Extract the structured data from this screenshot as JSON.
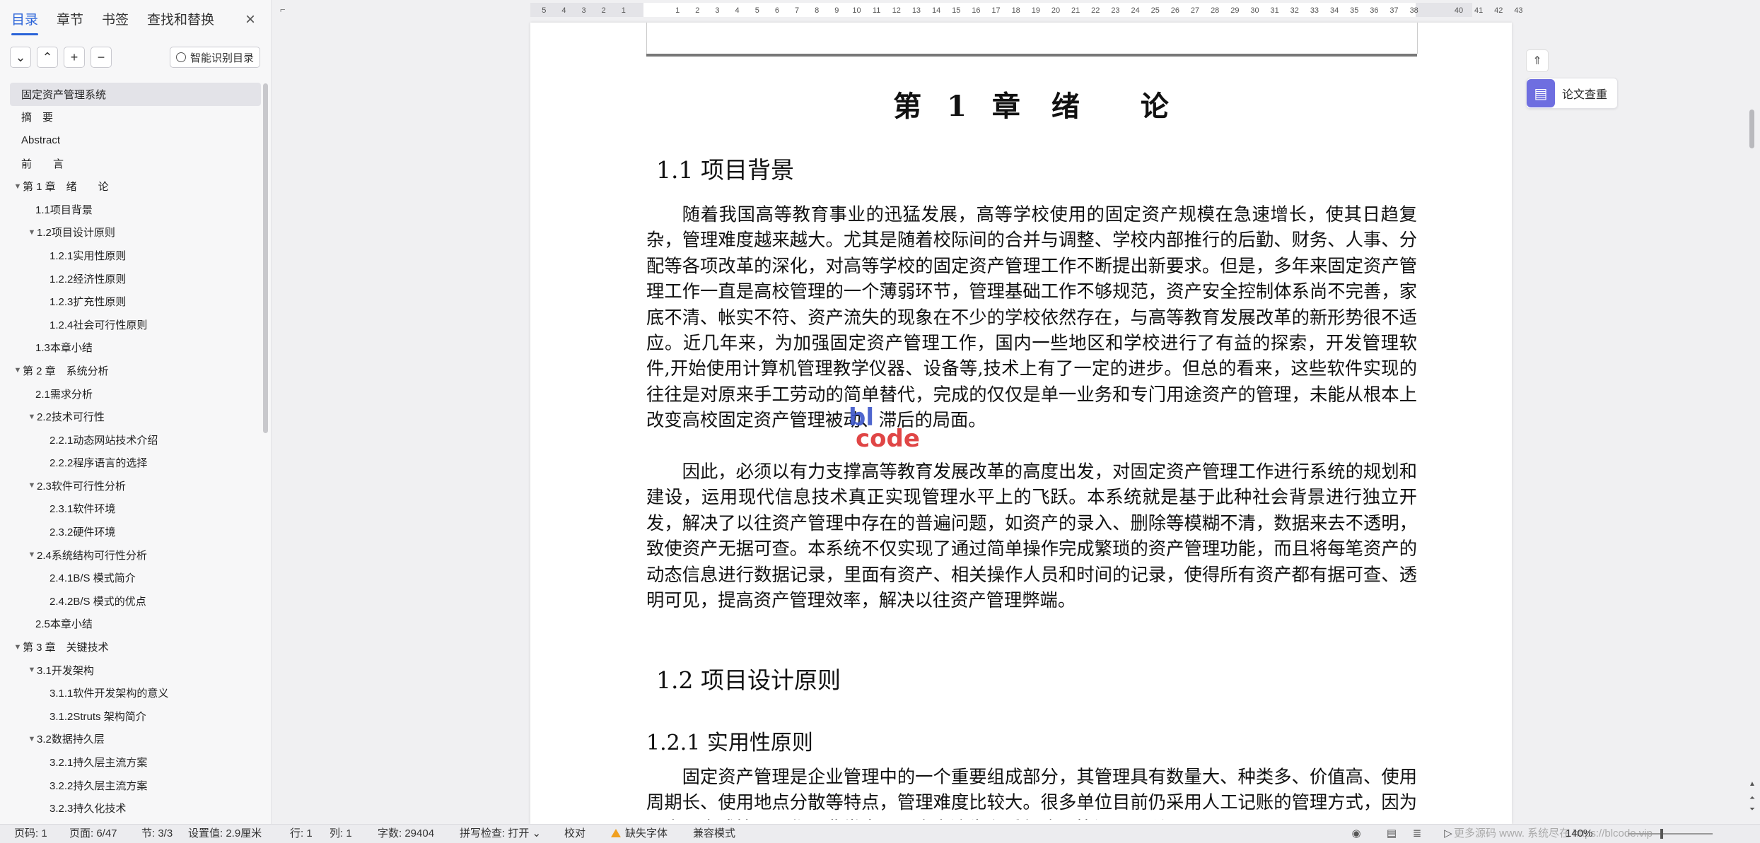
{
  "nav": {
    "tabs": [
      "目录",
      "章节",
      "书签",
      "查找和替换"
    ],
    "close_icon": "×",
    "tools": [
      {
        "name": "collapse-all-button",
        "icon": "chevron-down-icon",
        "glyph": "⌄"
      },
      {
        "name": "expand-all-button",
        "icon": "chevron-up-icon",
        "glyph": "⌃"
      },
      {
        "name": "add-level-button",
        "icon": "plus-icon",
        "glyph": "+"
      },
      {
        "name": "remove-level-button",
        "icon": "minus-icon",
        "glyph": "−"
      }
    ],
    "smart_toc_label": "智能识别目录",
    "toc": [
      {
        "label": "固定资产管理系统",
        "level": 0,
        "arrow": "",
        "active": true
      },
      {
        "label": "摘　要",
        "level": 0,
        "arrow": ""
      },
      {
        "label": "Abstract",
        "level": 0,
        "arrow": ""
      },
      {
        "label": "前　　言",
        "level": 0,
        "arrow": ""
      },
      {
        "label": "第 1 章　绪　　论",
        "level": 0,
        "arrow": "▼"
      },
      {
        "label": "1.1项目背景",
        "level": 1,
        "arrow": ""
      },
      {
        "label": "1.2项目设计原则",
        "level": 1,
        "arrow": "▼"
      },
      {
        "label": "1.2.1实用性原则",
        "level": 2,
        "arrow": ""
      },
      {
        "label": "1.2.2经济性原则",
        "level": 2,
        "arrow": ""
      },
      {
        "label": "1.2.3扩充性原则",
        "level": 2,
        "arrow": ""
      },
      {
        "label": "1.2.4社会可行性原则",
        "level": 2,
        "arrow": ""
      },
      {
        "label": "1.3本章小结",
        "level": 1,
        "arrow": ""
      },
      {
        "label": "第 2 章　系统分析",
        "level": 0,
        "arrow": "▼"
      },
      {
        "label": "2.1需求分析",
        "level": 1,
        "arrow": ""
      },
      {
        "label": "2.2技术可行性",
        "level": 1,
        "arrow": "▼"
      },
      {
        "label": "2.2.1动态网站技术介绍",
        "level": 2,
        "arrow": ""
      },
      {
        "label": "2.2.2程序语言的选择",
        "level": 2,
        "arrow": ""
      },
      {
        "label": "2.3软件可行性分析",
        "level": 1,
        "arrow": "▼"
      },
      {
        "label": "2.3.1软件环境",
        "level": 2,
        "arrow": ""
      },
      {
        "label": "2.3.2硬件环境",
        "level": 2,
        "arrow": ""
      },
      {
        "label": "2.4系统结构可行性分析",
        "level": 1,
        "arrow": "▼"
      },
      {
        "label": "2.4.1B/S 模式简介",
        "level": 2,
        "arrow": ""
      },
      {
        "label": "2.4.2B/S 模式的优点",
        "level": 2,
        "arrow": ""
      },
      {
        "label": "2.5本章小结",
        "level": 1,
        "arrow": ""
      },
      {
        "label": "第 3 章　关键技术",
        "level": 0,
        "arrow": "▼"
      },
      {
        "label": "3.1开发架构",
        "level": 1,
        "arrow": "▼"
      },
      {
        "label": "3.1.1软件开发架构的意义",
        "level": 2,
        "arrow": ""
      },
      {
        "label": "3.1.2Struts 架构简介",
        "level": 2,
        "arrow": ""
      },
      {
        "label": "3.2数据持久层",
        "level": 1,
        "arrow": "▼"
      },
      {
        "label": "3.2.1持久层主流方案",
        "level": 2,
        "arrow": ""
      },
      {
        "label": "3.2.2持久层主流方案",
        "level": 2,
        "arrow": ""
      },
      {
        "label": "3.2.3持久化技术",
        "level": 2,
        "arrow": ""
      }
    ]
  },
  "ruler": {
    "left_ticks": [
      "5",
      "4",
      "3",
      "2",
      "1"
    ],
    "ticks": [
      "1",
      "2",
      "3",
      "4",
      "5",
      "6",
      "7",
      "8",
      "9",
      "10",
      "11",
      "12",
      "13",
      "14",
      "15",
      "16",
      "17",
      "18",
      "19",
      "20",
      "21",
      "22",
      "23",
      "24",
      "25",
      "26",
      "27",
      "28",
      "29",
      "30",
      "31",
      "32",
      "33",
      "34",
      "35",
      "36",
      "37",
      "38"
    ],
    "right_ticks": [
      "40",
      "41",
      "42",
      "43"
    ]
  },
  "doc": {
    "chapter_title": "第 1 章　绪　　论",
    "h_1_1": "1.1  项目背景",
    "p1": "随着我国高等教育事业的迅猛发展，高等学校使用的固定资产规模在急速增长，使其日趋复杂，管理难度越来越大。尤其是随着校际间的合并与调整、学校内部推行的后勤、财务、人事、分配等各项改革的深化，对高等学校的固定资产管理工作不断提出新要求。但是，多年来固定资产管理工作一直是高校管理的一个薄弱环节，管理基础工作不够规范，资产安全控制体系尚不完善，家底不清、帐实不符、资产流失的现象在不少的学校依然存在，与高等教育发展改革的新形势很不适应。近几年来，为加强固定资产管理工作，国内一些地区和学校进行了有益的探索，开发管理软件,开始使用计算机管理教学仪器、设备等,技术上有了一定的进步。但总的看来，这些软件实现的往往是对原来手工劳动的简单替代，完成的仅仅是单一业务和专门用途资产的管理，未能从根本上改变高校固定资产管理被动、滞后的局面。",
    "p2": "因此，必须以有力支撑高等教育发展改革的高度出发，对固定资产管理工作进行系统的规划和建设，运用现代信息技术真正实现管理水平上的飞跃。本系统就是基于此种社会背景进行独立开发，解决了以往资产管理中存在的普遍问题，如资产的录入、删除等模糊不清，数据来去不透明，致使资产无据可查。本系统不仅实现了通过简单操作完成繁琐的资产管理功能，而且将每笔资产的动态信息进行数据记录，里面有资产、相关操作人员和时间的记录，使得所有资产都有据可查、透明可见，提高资产管理效率，解决以往资产管理弊端。",
    "h_1_2": "1.2  项目设计原则",
    "h_1_2_1": "1.2.1  实用性原则",
    "p3": "固定资产管理是企业管理中的一个重要组成部分，其管理具有数量大、种类多、价值高、使用周期长、使用地点分散等特点，管理难度比较大。很多单位目前仍采用人工记账的管理方式，因为以人工方式管理工作量非常大，且资产流失和重复购置等问题，所",
    "watermark_top": "bl",
    "watermark_bottom": "code"
  },
  "side": {
    "up_icon": "⇑",
    "paper_check_label": "论文查重"
  },
  "status": {
    "page_num": "页码: 1",
    "page_of": "页面: 6/47",
    "section": "节: 3/3",
    "setting": "设置值: 2.9厘米",
    "row": "行: 1",
    "col": "列: 1",
    "word_count": "字数: 29404",
    "spell_check": "拼写检查: 打开",
    "proofread": "校对",
    "missing_font": "缺失字体",
    "compat_mode": "兼容模式",
    "zoom": "140%",
    "overlay_text": "更多源码 www.  系统尽在 https://blcode.vip"
  }
}
